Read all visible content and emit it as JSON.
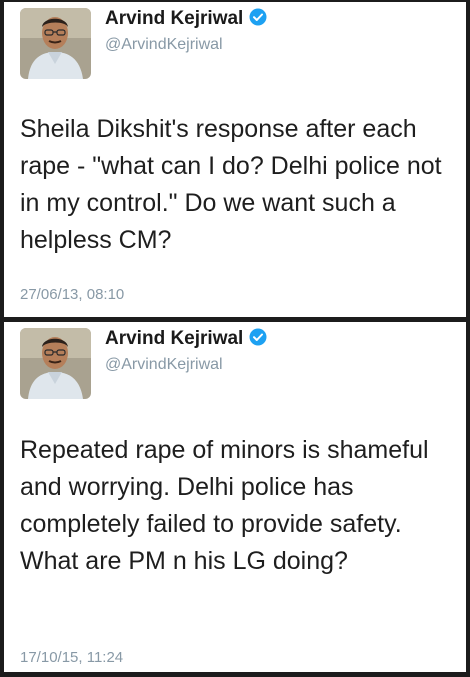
{
  "tweets": [
    {
      "author": {
        "name": "Arvind Kejriwal",
        "handle": "@ArvindKejriwal",
        "verified": true,
        "avatar_icon": "profile-photo"
      },
      "text": "Sheila Dikshit's response after each rape - \"what can I do? Delhi police not in my control.\" Do we want such a helpless CM?",
      "timestamp": "27/06/13, 08:10"
    },
    {
      "author": {
        "name": "Arvind Kejriwal",
        "handle": "@ArvindKejriwal",
        "verified": true,
        "avatar_icon": "profile-photo"
      },
      "text": "Repeated rape of minors is shameful and worrying. Delhi police has completely failed to provide safety. What are PM n his LG doing?",
      "timestamp": "17/10/15, 11:24"
    }
  ],
  "colors": {
    "background": "#1c1c1c",
    "card": "#ffffff",
    "verified_badge": "#1da1f2",
    "secondary_text": "#8899a6",
    "primary_text": "#1e1e1e"
  }
}
